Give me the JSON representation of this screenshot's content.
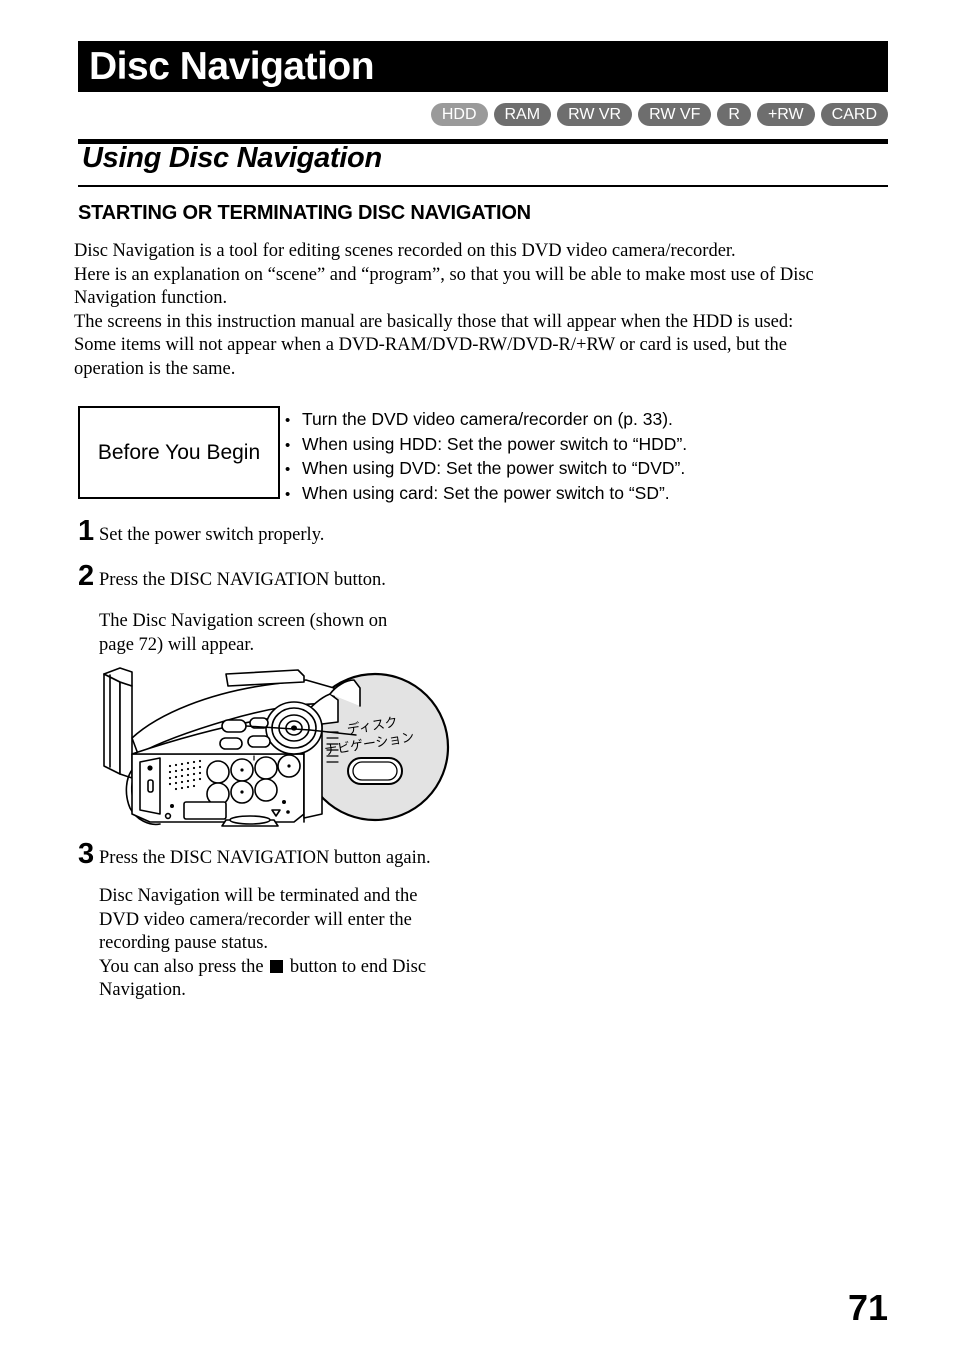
{
  "header": {
    "chapter_title": "Disc Navigation",
    "chapter_title_bg": "#000000",
    "chapter_title_color": "#ffffff"
  },
  "media_badges": [
    {
      "label": "HDD",
      "color": "#9a9a9a",
      "active": true
    },
    {
      "label": "RAM",
      "color": "#6e6e6e",
      "active": false
    },
    {
      "label": "RW VR",
      "color": "#6e6e6e",
      "active": false
    },
    {
      "label": "RW VF",
      "color": "#6e6e6e",
      "active": false
    },
    {
      "label": "R",
      "color": "#6e6e6e",
      "active": false
    },
    {
      "label": "+RW",
      "color": "#6e6e6e",
      "active": false
    },
    {
      "label": "CARD",
      "color": "#6e6e6e",
      "active": false
    }
  ],
  "section": {
    "title": "Using Disc Navigation",
    "subsection_title": "STARTING OR TERMINATING DISC NAVIGATION"
  },
  "intro_lines": [
    "Disc Navigation is a tool for editing scenes recorded on this DVD video camera/recorder.",
    "Here is an explanation on “scene” and “program”, so that you will be able to make most use of Disc",
    "Navigation function.",
    "The screens in this instruction manual are basically those that will appear when the HDD is used:",
    "Some items will not appear when a DVD-RAM/DVD-RW/DVD-R/+RW or card is used, but the",
    "operation is the same."
  ],
  "before_you_begin": {
    "label": "Before You Begin",
    "bullet_char": "•",
    "items": [
      "Turn the DVD video camera/recorder on (p. 33).",
      "When using HDD: Set the power switch to “HDD”.",
      "When using DVD: Set the power switch to “DVD”.",
      "When using card: Set the power switch to “SD”."
    ]
  },
  "steps": [
    {
      "number": "1",
      "text": "Set the power switch properly.",
      "body_lines": []
    },
    {
      "number": "2",
      "text": "Press the DISC NAVIGATION button.",
      "body_lines": [
        "The Disc Navigation screen (shown on",
        "page 72) will appear."
      ]
    },
    {
      "number": "3",
      "text": "Press the DISC NAVIGATION button again.",
      "body_lines": [
        "Disc Navigation will be terminated and the",
        "DVD video camera/recorder will enter the",
        "recording pause status.",
        "You can also press the ■ button to end Disc",
        "Navigation."
      ],
      "body_line_4_pre": "You can also press the ",
      "body_line_4_post": " button to end Disc"
    }
  ],
  "illustration": {
    "caption_jp_line1": "ディスク",
    "caption_jp_line2": "ナビゲーション",
    "callout_fill": "#e3e3e3",
    "body_fill": "#ffffff",
    "outline": "#000000"
  },
  "footer": {
    "page_number": "71"
  }
}
